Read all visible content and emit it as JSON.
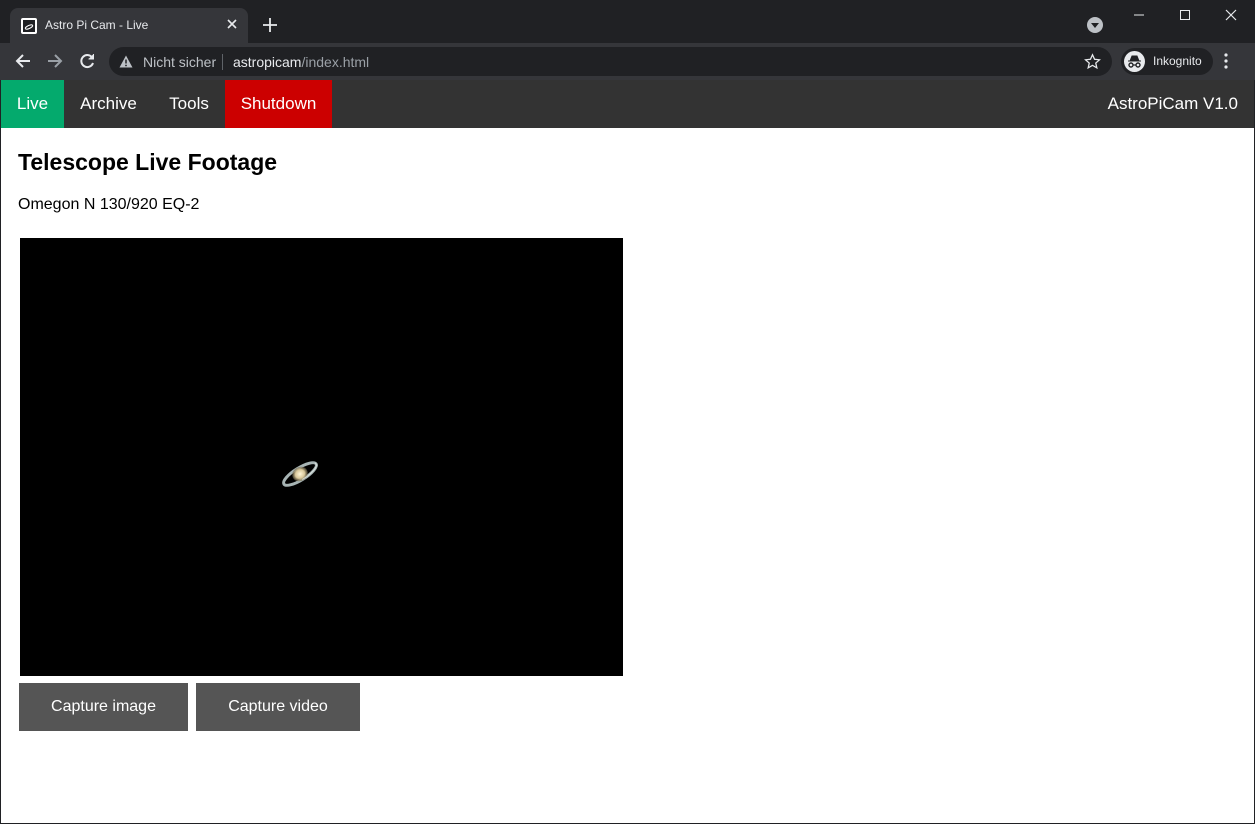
{
  "browser": {
    "tab_title": "Astro Pi Cam - Live",
    "security_label": "Nicht sicher",
    "url_host": "astropicam",
    "url_path": "/index.html",
    "profile_label": "Inkognito"
  },
  "nav": {
    "items": [
      {
        "label": "Live",
        "color": "#04aa6d"
      },
      {
        "label": "Archive"
      },
      {
        "label": "Tools"
      },
      {
        "label": "Shutdown",
        "color": "#cc0000"
      }
    ],
    "brand": "AstroPiCam V1.0",
    "background": "#333333"
  },
  "main": {
    "title": "Telescope Live Footage",
    "telescope": "Omegon N 130/920 EQ-2",
    "buttons": {
      "capture_image": "Capture image",
      "capture_video": "Capture video"
    }
  },
  "icons": [
    "favicon-icon",
    "close-icon",
    "plus-icon",
    "tab-search-icon",
    "minimize-icon",
    "maximize-icon",
    "window-close-icon",
    "back-arrow-icon",
    "forward-arrow-icon",
    "reload-icon",
    "warning-icon",
    "star-icon",
    "incognito-icon",
    "kebab-menu-icon"
  ]
}
